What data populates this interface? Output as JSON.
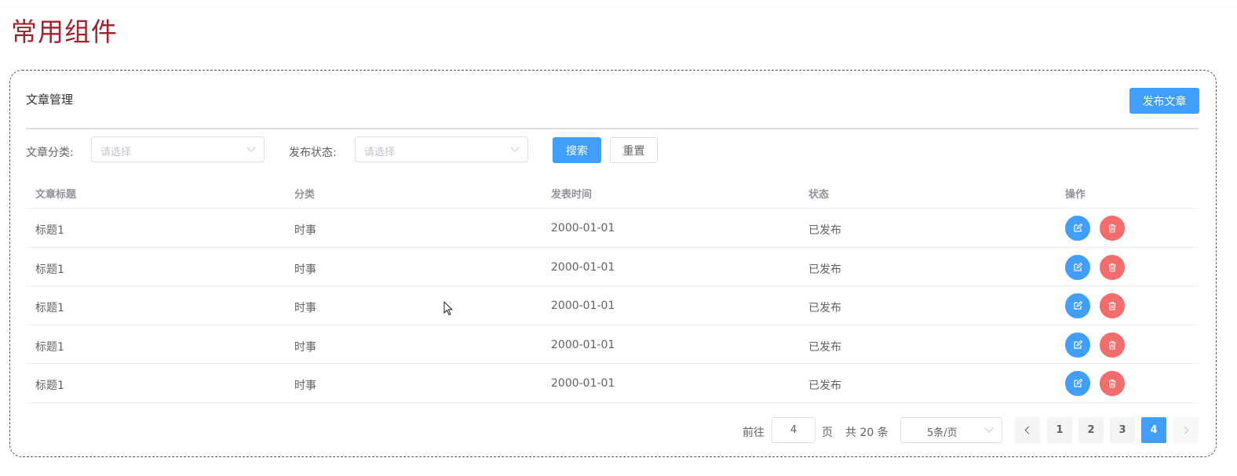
{
  "page_title": "常用组件",
  "card": {
    "title": "文章管理",
    "publish_label": "发布文章"
  },
  "filters": {
    "category_label": "文章分类:",
    "category_placeholder": "请选择",
    "status_label": "发布状态:",
    "status_placeholder": "请选择",
    "search_label": "搜索",
    "reset_label": "重置"
  },
  "table": {
    "columns": [
      "文章标题",
      "分类",
      "发表时间",
      "状态",
      "操作"
    ],
    "rows": [
      {
        "title": "标题1",
        "category": "时事",
        "date": "2000-01-01",
        "status": "已发布"
      },
      {
        "title": "标题1",
        "category": "时事",
        "date": "2000-01-01",
        "status": "已发布"
      },
      {
        "title": "标题1",
        "category": "时事",
        "date": "2000-01-01",
        "status": "已发布"
      },
      {
        "title": "标题1",
        "category": "时事",
        "date": "2000-01-01",
        "status": "已发布"
      },
      {
        "title": "标题1",
        "category": "时事",
        "date": "2000-01-01",
        "status": "已发布"
      }
    ],
    "edit_icon": "edit-icon",
    "delete_icon": "delete-icon"
  },
  "pagination": {
    "goto_prefix": "前往",
    "goto_value": "4",
    "goto_suffix": "页",
    "total_text": "共 20 条",
    "page_size": "5条/页",
    "pages": [
      "1",
      "2",
      "3",
      "4"
    ],
    "current_page": "4"
  },
  "colors": {
    "primary": "#409eff",
    "danger": "#f56c6c",
    "title": "#a0222e"
  }
}
